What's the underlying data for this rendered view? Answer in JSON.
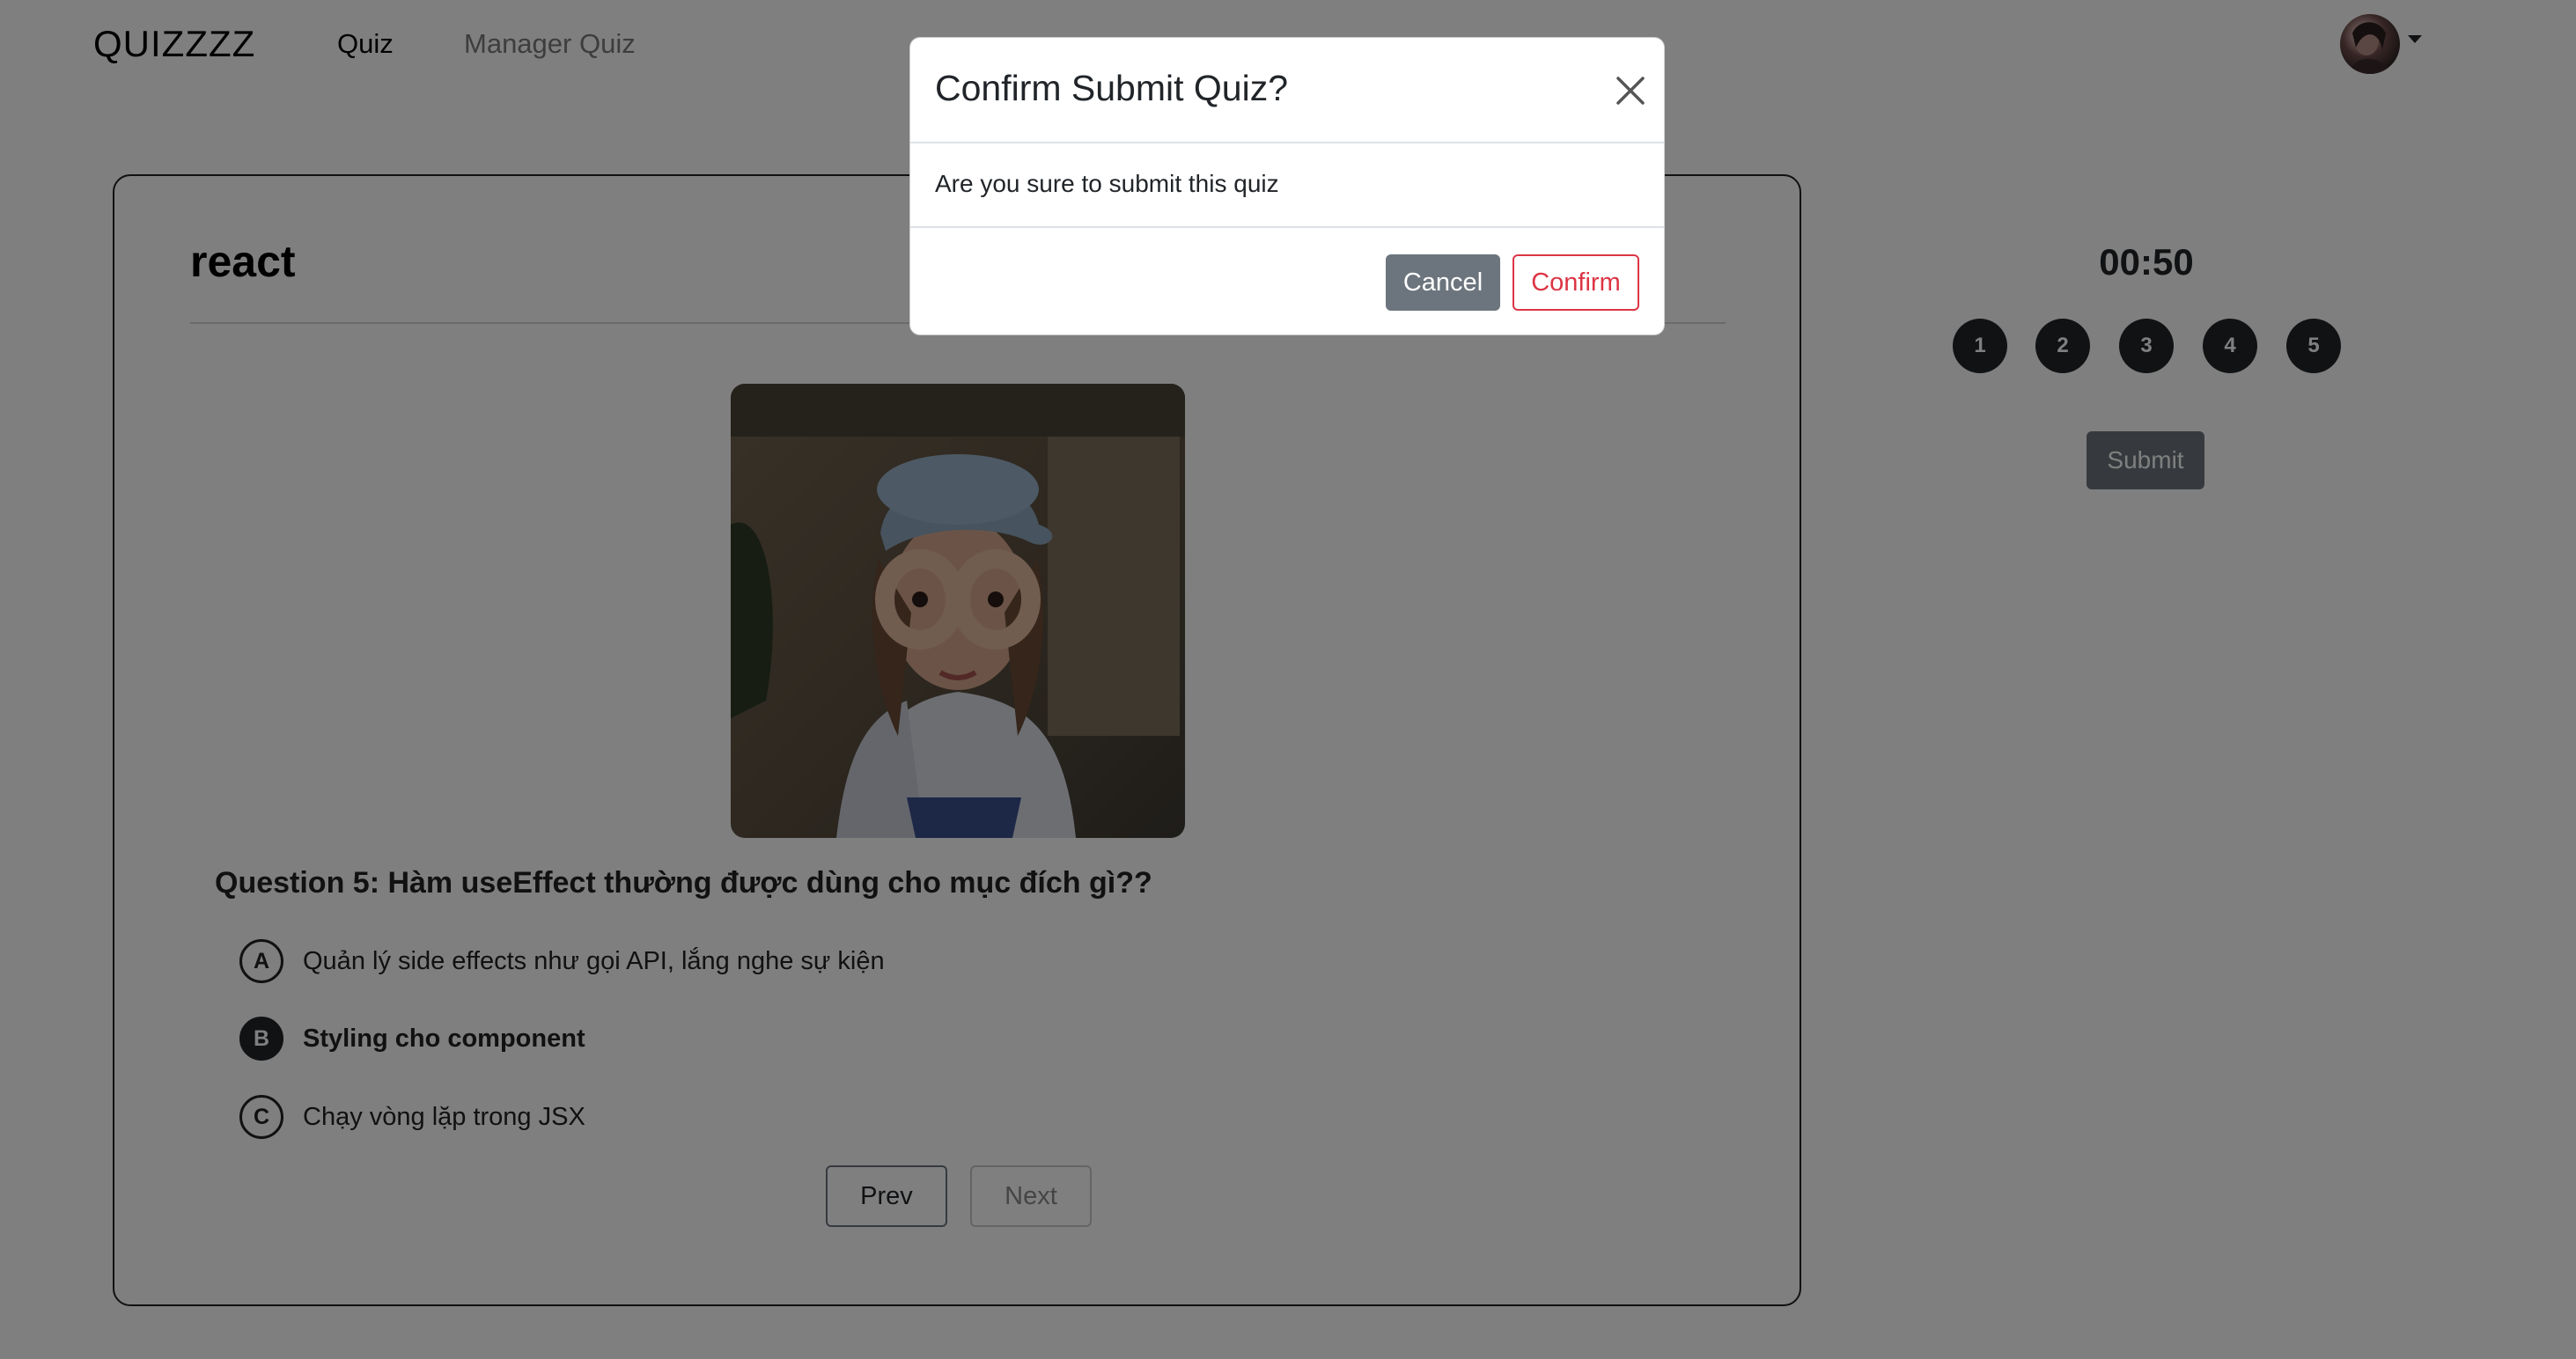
{
  "navbar": {
    "brand": "QUIZZZZ",
    "links": [
      {
        "label": "Quiz",
        "active": true
      },
      {
        "label": "Manager Quiz",
        "active": false
      }
    ]
  },
  "quiz": {
    "title": "react",
    "question": "Question 5: Hàm useEffect thường được dùng cho mục đích gì??",
    "answers": [
      {
        "letter": "A",
        "text": "Quản lý side effects như gọi API, lắng nghe sự kiện",
        "selected": false
      },
      {
        "letter": "B",
        "text": "Styling cho component",
        "selected": true
      },
      {
        "letter": "C",
        "text": "Chạy vòng lặp trong JSX",
        "selected": false
      }
    ],
    "prev_label": "Prev",
    "next_label": "Next"
  },
  "panel": {
    "timer": "00:50",
    "question_numbers": [
      "1",
      "2",
      "3",
      "4",
      "5"
    ],
    "submit_label": "Submit"
  },
  "modal": {
    "title": "Confirm Submit Quiz?",
    "body": "Are you sure to submit this quiz",
    "cancel_label": "Cancel",
    "confirm_label": "Confirm"
  },
  "colors": {
    "primary_dark": "#212529",
    "secondary": "#6c757d",
    "danger": "#dc3545",
    "backdrop": "rgba(0,0,0,0.5)"
  }
}
